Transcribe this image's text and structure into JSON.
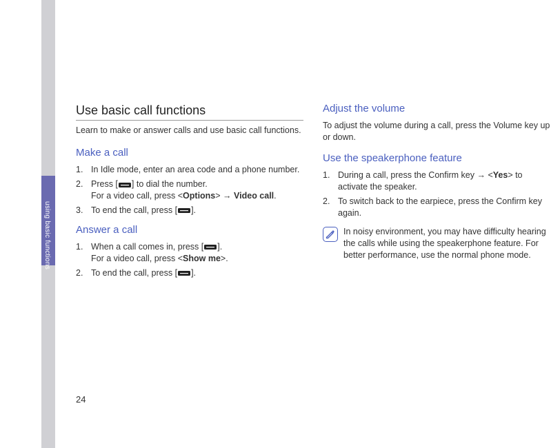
{
  "sidebar": {
    "label": "using basic functions"
  },
  "page": {
    "number": "24"
  },
  "col1": {
    "title": "Use basic call functions",
    "intro": "Learn to make or answer calls and use basic call functions.",
    "make_call": {
      "heading": "Make a call",
      "step1": "In Idle mode, enter an area code and a phone number.",
      "step2_pre": "Press [",
      "step2_post": "] to dial the number.",
      "step2_line2_a": "For a video call, press <",
      "step2_line2_b": "Options",
      "step2_line2_c": "> → ",
      "step2_line2_d": "Video call",
      "step2_line2_e": ".",
      "step3_pre": "To end the call, press [",
      "step3_post": "]."
    },
    "answer_call": {
      "heading": "Answer a call",
      "step1_pre": "When a call comes in, press [",
      "step1_post": "].",
      "step1_line2_a": "For a video call, press <",
      "step1_line2_b": "Show me",
      "step1_line2_c": ">.",
      "step2_pre": "To end the call, press [",
      "step2_post": "]."
    }
  },
  "col2": {
    "volume": {
      "heading": "Adjust the volume",
      "text": "To adjust the volume during a call, press the Volume key up or down."
    },
    "speaker": {
      "heading": "Use the speakerphone feature",
      "step1_a": "During a call, press the Confirm key → <",
      "step1_b": "Yes",
      "step1_c": "> to activate the speaker.",
      "step2": "To switch back to the earpiece, press the Confirm key again.",
      "note": "In noisy environment, you may have difficulty hearing the calls while using the speakerphone feature. For better performance, use the normal phone mode."
    }
  }
}
